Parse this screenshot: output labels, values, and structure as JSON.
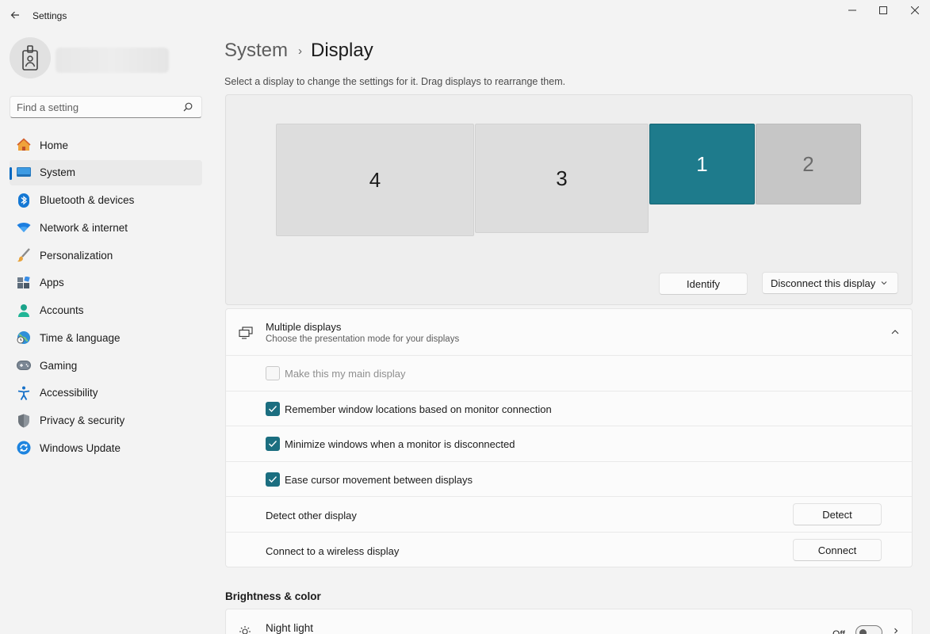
{
  "window": {
    "title": "Settings",
    "controls": {
      "minimize": "minimize-icon",
      "maximize": "maximize-icon",
      "close": "close-icon"
    }
  },
  "search": {
    "placeholder": "Find a setting",
    "value": ""
  },
  "sidebar": {
    "items": [
      {
        "label": "Home",
        "icon": "home-icon",
        "active": false
      },
      {
        "label": "System",
        "icon": "system-icon",
        "active": true
      },
      {
        "label": "Bluetooth & devices",
        "icon": "bluetooth-icon",
        "active": false
      },
      {
        "label": "Network & internet",
        "icon": "wifi-icon",
        "active": false
      },
      {
        "label": "Personalization",
        "icon": "brush-icon",
        "active": false
      },
      {
        "label": "Apps",
        "icon": "apps-icon",
        "active": false
      },
      {
        "label": "Accounts",
        "icon": "accounts-icon",
        "active": false
      },
      {
        "label": "Time & language",
        "icon": "globe-clock-icon",
        "active": false
      },
      {
        "label": "Gaming",
        "icon": "gamepad-icon",
        "active": false
      },
      {
        "label": "Accessibility",
        "icon": "accessibility-icon",
        "active": false
      },
      {
        "label": "Privacy & security",
        "icon": "shield-icon",
        "active": false
      },
      {
        "label": "Windows Update",
        "icon": "update-icon",
        "active": false
      }
    ]
  },
  "breadcrumb": {
    "parent": "System",
    "separator": "›",
    "current": "Display"
  },
  "page": {
    "subtitle": "Select a display to change the settings for it. Drag displays to rearrange them."
  },
  "displays": {
    "monitors": [
      {
        "label": "4",
        "selected": false
      },
      {
        "label": "3",
        "selected": false
      },
      {
        "label": "1",
        "selected": true
      },
      {
        "label": "2",
        "selected": false
      }
    ],
    "identify_label": "Identify",
    "disconnect_label": "Disconnect this display"
  },
  "multiple_displays": {
    "title": "Multiple displays",
    "subtitle": "Choose the presentation mode for your displays",
    "expanded": true,
    "options": [
      {
        "label": "Make this my main display",
        "checked": false,
        "disabled": true
      },
      {
        "label": "Remember window locations based on monitor connection",
        "checked": true,
        "disabled": false
      },
      {
        "label": "Minimize windows when a monitor is disconnected",
        "checked": true,
        "disabled": false
      },
      {
        "label": "Ease cursor movement between displays",
        "checked": true,
        "disabled": false
      }
    ],
    "detect": {
      "label": "Detect other display",
      "button": "Detect"
    },
    "wireless": {
      "label": "Connect to a wireless display",
      "button": "Connect"
    }
  },
  "brightness": {
    "section_title": "Brightness & color",
    "night_light": {
      "label": "Night light",
      "state": "Off",
      "on": false
    }
  },
  "colors": {
    "accent": "#0067c0",
    "selected_monitor": "#1e7b8c",
    "checkbox": "#1b6e80"
  }
}
